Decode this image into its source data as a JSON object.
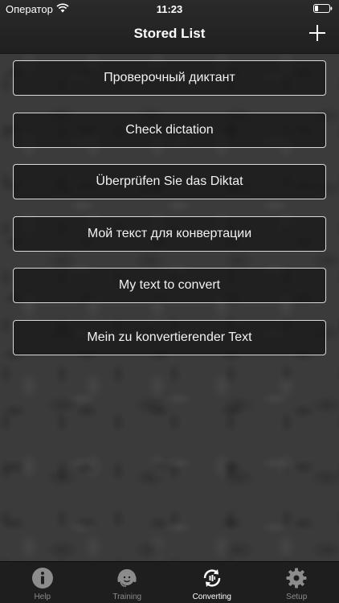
{
  "status_bar": {
    "carrier": "Оператор",
    "time": "11:23"
  },
  "header": {
    "title": "Stored List",
    "add_icon": "plus-icon"
  },
  "list": {
    "items": [
      "Проверочный диктант",
      "Check dictation",
      "Überprüfen Sie das Diktat",
      "Мой текст для конвертации",
      "My text to convert",
      "Mein zu konvertierender Text"
    ]
  },
  "tabbar": {
    "tabs": [
      {
        "label": "Help",
        "icon": "info-icon"
      },
      {
        "label": "Training",
        "icon": "headset-face-icon"
      },
      {
        "label": "Converting",
        "icon": "convert-icon",
        "active": true
      },
      {
        "label": "Setup",
        "icon": "gear-icon"
      }
    ]
  },
  "colors": {
    "tab_active": "#ffffff",
    "tab_inactive": "#8c8c8c",
    "item_border": "#d9d9d9"
  }
}
